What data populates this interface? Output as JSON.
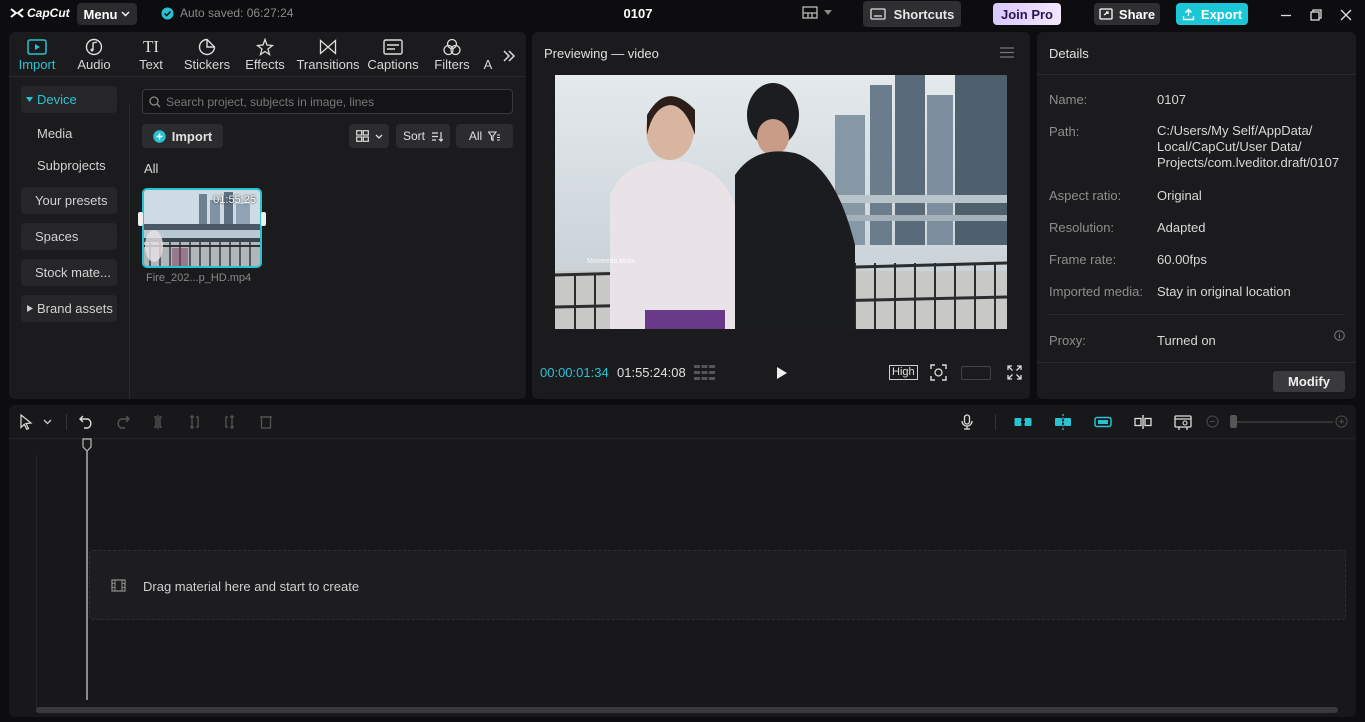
{
  "app": {
    "logo_text": "CapCut",
    "menu_label": "Menu",
    "autosave": "Auto saved: 06:27:24",
    "project_title": "0107"
  },
  "titlebar": {
    "shortcuts_label": "Shortcuts",
    "joinpro_label": "Join Pro",
    "share_label": "Share",
    "export_label": "Export"
  },
  "toolbar": {
    "tabs": [
      {
        "label": "Import",
        "icon": "import-icon",
        "active": true
      },
      {
        "label": "Audio",
        "icon": "audio-icon"
      },
      {
        "label": "Text",
        "icon": "text-icon"
      },
      {
        "label": "Stickers",
        "icon": "stickers-icon"
      },
      {
        "label": "Effects",
        "icon": "effects-icon"
      },
      {
        "label": "Transitions",
        "icon": "transitions-icon"
      },
      {
        "label": "Captions",
        "icon": "captions-icon"
      },
      {
        "label": "Filters",
        "icon": "filters-icon"
      },
      {
        "label": "A",
        "icon": "more-tab-icon"
      }
    ]
  },
  "sidebar": {
    "items": [
      {
        "label": "Device",
        "expanded": true
      },
      {
        "label": "Media"
      },
      {
        "label": "Subprojects"
      },
      {
        "label": "Your presets"
      },
      {
        "label": "Spaces"
      },
      {
        "label": "Stock mate..."
      },
      {
        "label": "Brand assets"
      }
    ]
  },
  "media": {
    "search_placeholder": "Search project, subjects in image, lines",
    "import_label": "Import",
    "sort_label": "Sort",
    "filter_all_label": "All",
    "section_label": "All",
    "items": [
      {
        "duration": "01:55:25",
        "filename": "Fire_202...p_HD.mp4"
      }
    ]
  },
  "preview": {
    "title": "Previewing — video",
    "watermark": "Movieeda.Mobi",
    "current_time": "00:00:01:34",
    "total_time": "01:55:24:08",
    "quality_label": "High"
  },
  "details": {
    "title": "Details",
    "fields": [
      {
        "label": "Name:",
        "value": "0107"
      },
      {
        "label": "Path:",
        "value_lines": [
          "C:/Users/My Self/AppData/",
          "Local/CapCut/User Data/",
          "Projects/com.lveditor.draft/0107"
        ]
      },
      {
        "label": "Aspect ratio:",
        "value": "Original"
      },
      {
        "label": "Resolution:",
        "value": "Adapted"
      },
      {
        "label": "Frame rate:",
        "value": "60.00fps"
      },
      {
        "label": "Imported media:",
        "value": "Stay in original location"
      },
      {
        "label": "Proxy:",
        "value": "Turned on"
      }
    ],
    "modify_label": "Modify"
  },
  "timeline": {
    "drop_hint": "Drag material here and start to create"
  },
  "colors": {
    "accent": "#27c3d3",
    "export_bg": "#1bc6d6",
    "panel": "#1b1b1d",
    "background": "#0d0d0f"
  }
}
